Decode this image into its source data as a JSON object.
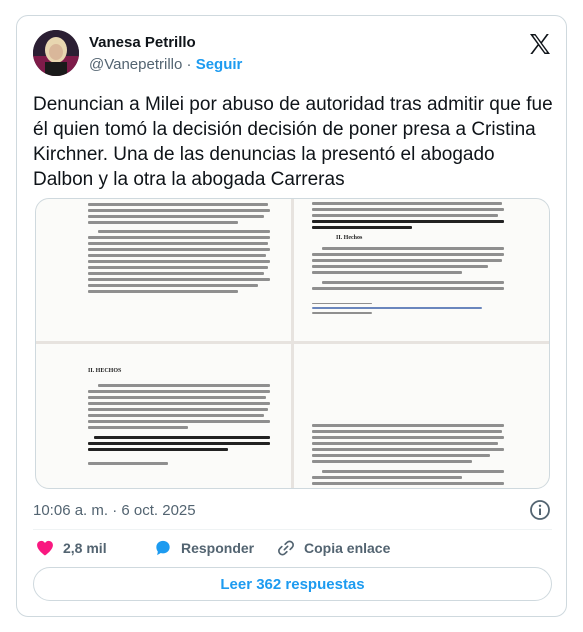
{
  "tweet": {
    "author": {
      "display_name": "Vanesa Petrillo",
      "handle": "@Vanepetrillo",
      "follow_label": "Seguir"
    },
    "text": "Denuncian a Milei por abuso de autoridad tras admitir que fue él quien tomó la decisión decisión de poner presa a Cristina Kirchner. Una de las denuncias la presentó el abogado Dalbon y la otra la abogada Carreras",
    "media": {
      "doc_snippets": {
        "section_heading_left": "II. HECHOS",
        "section_heading_right": "II. Hechos",
        "quote_bold": "\"… lo puedo asegurar que esto es la venganza de que soy el primer presidente que tomó la decisión de que vaya presa…\""
      }
    },
    "timestamp": "10:06 a. m. · 6 oct. 2025",
    "actions": {
      "likes": "2,8 mil",
      "reply_label": "Responder",
      "copy_label": "Copia enlace"
    },
    "read_replies_label": "Leer 362 respuestas"
  },
  "colors": {
    "accent": "#1d9bf0",
    "like": "#f91880",
    "text_primary": "#0f1419",
    "text_secondary": "#536471"
  },
  "icons": [
    "x-logo-icon",
    "info-icon",
    "heart-icon",
    "reply-bubble-icon",
    "link-icon"
  ]
}
